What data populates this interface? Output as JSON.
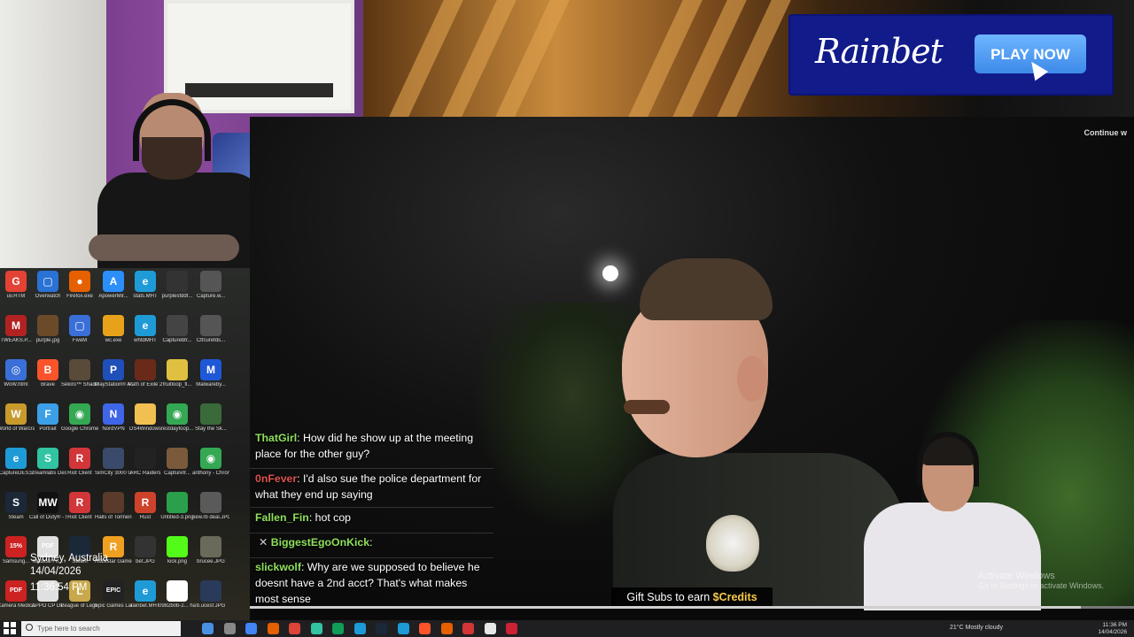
{
  "ad": {
    "brand": "Rainbet",
    "cta": "PLAY NOW"
  },
  "video": {
    "continue_label": "Continue w",
    "gift": {
      "prefix": "Gift Subs to earn ",
      "highlight": "$Credits"
    },
    "progress_fraction": 0.94,
    "activate_title": "Activate Windows",
    "activate_sub": "Go to Settings to activate Windows."
  },
  "chat": [
    {
      "user": "ThatGirl",
      "color": "#8ee05a",
      "text": "How did he show up at the meeting place for the other guy?"
    },
    {
      "user": "0nFever",
      "color": "#d9534f",
      "text": "I'd also sue the police department for what they end up saying"
    },
    {
      "user": "Fallen_Fin",
      "color": "#8ee05a",
      "text": "hot cop"
    },
    {
      "user": "BiggestEgoOnKick",
      "color": "#8ee05a",
      "text": ""
    },
    {
      "user": "slickwolf",
      "color": "#8ee05a",
      "text": "Why are we supposed to believe he doesnt have a 2nd acct? That's what makes most sense"
    }
  ],
  "desktop": {
    "location": "Sydney, Australia",
    "date": "14/04/2026",
    "time": "11:36:54 PM",
    "icons": [
      {
        "label": "uv.HTM",
        "color": "#e34234",
        "glyph": "G"
      },
      {
        "label": "Overwatch",
        "color": "#2a72d5",
        "glyph": "▢"
      },
      {
        "label": "Firefox.exe",
        "color": "#e66000",
        "glyph": "●"
      },
      {
        "label": "ApowerMir...",
        "color": "#2c8ef8",
        "glyph": "A"
      },
      {
        "label": "stats.MHT",
        "color": "#1e9bd7",
        "glyph": "e"
      },
      {
        "label": "purplesfddf...",
        "color": "#333333",
        "glyph": ""
      },
      {
        "label": "Capture.w...",
        "color": "#555555",
        "glyph": ""
      },
      {
        "label": "TWEAKS.P...",
        "color": "#b22222",
        "glyph": "M"
      },
      {
        "label": "purple.jpg",
        "color": "#6b4a2a",
        "glyph": ""
      },
      {
        "label": "FiveM",
        "color": "#3a6fd8",
        "glyph": "▢"
      },
      {
        "label": "wc.exe",
        "color": "#e8a21a",
        "glyph": ""
      },
      {
        "label": "whtdMHT",
        "color": "#1e9bd7",
        "glyph": "e"
      },
      {
        "label": "Capturebtr...",
        "color": "#444444",
        "glyph": ""
      },
      {
        "label": "Ctfcurefds...",
        "color": "#555555",
        "glyph": ""
      },
      {
        "label": "WoW.html",
        "color": "#3a6fd8",
        "glyph": "◎"
      },
      {
        "label": "Brave",
        "color": "#fb542b",
        "glyph": "B"
      },
      {
        "label": "Sekiro™ Shadows D...",
        "color": "#5a4a3a",
        "glyph": ""
      },
      {
        "label": "PlayStation® Accessories",
        "color": "#1f4fb8",
        "glyph": "P"
      },
      {
        "label": "Path of Exile 2",
        "color": "#6a2a1a",
        "glyph": ""
      },
      {
        "label": "fruitloop_fl...",
        "color": "#e0c040",
        "glyph": ""
      },
      {
        "label": "Malwareby...",
        "color": "#1f58d6",
        "glyph": "M"
      },
      {
        "label": "World of Warcra...",
        "color": "#c89a2c",
        "glyph": "W"
      },
      {
        "label": "Portrait",
        "color": "#3c9fe8",
        "glyph": "F"
      },
      {
        "label": "Google Chrome",
        "color": "#34a853",
        "glyph": "◉"
      },
      {
        "label": "NordVPN",
        "color": "#3f65e8",
        "glyph": "N"
      },
      {
        "label": "DS4Windows",
        "color": "#f0c050",
        "glyph": ""
      },
      {
        "label": "restdayfoop...",
        "color": "#34a853",
        "glyph": "◉"
      },
      {
        "label": "Stay the Sk...",
        "color": "#3a6a3a",
        "glyph": ""
      },
      {
        "label": "CaptureDES...",
        "color": "#1e9bd7",
        "glyph": "e"
      },
      {
        "label": "Streamlabs Desktop",
        "color": "#31c3a2",
        "glyph": "S"
      },
      {
        "label": "Riot Client",
        "color": "#d13639",
        "glyph": "R"
      },
      {
        "label": "SimCity 3000 Unlimited",
        "color": "#3a4a6a",
        "glyph": ""
      },
      {
        "label": "ARC Raiders",
        "color": "#222222",
        "glyph": ""
      },
      {
        "label": "Capturefr...",
        "color": "#7a5a3a",
        "glyph": ""
      },
      {
        "label": "anthony - Chrome",
        "color": "#34a853",
        "glyph": "◉"
      },
      {
        "label": "Steam",
        "color": "#1b2838",
        "glyph": "S"
      },
      {
        "label": "Call of Duty® - Mo...",
        "color": "#111111",
        "glyph": "MW"
      },
      {
        "label": "Riot Client",
        "color": "#d13639",
        "glyph": "R"
      },
      {
        "label": "Halls of Torment",
        "color": "#5a3a2a",
        "glyph": ""
      },
      {
        "label": "Rust",
        "color": "#ce422b",
        "glyph": "R"
      },
      {
        "label": "Untitled-3.png",
        "color": "#2aa04a",
        "glyph": ""
      },
      {
        "label": "new.rb deal.JPG",
        "color": "#5a5a5a",
        "glyph": ""
      },
      {
        "label": "Samsung...",
        "color": "#cc2222",
        "glyph": "15%"
      },
      {
        "label": "Medical Fit...",
        "color": "#e0e0e0",
        "glyph": "PDF"
      },
      {
        "label": "Steam",
        "color": "#1b2838",
        "glyph": ""
      },
      {
        "label": "Rockstar Games...",
        "color": "#f0a020",
        "glyph": "R"
      },
      {
        "label": "bet.JPG",
        "color": "#333333",
        "glyph": ""
      },
      {
        "label": "kick.png",
        "color": "#53fc18",
        "glyph": ""
      },
      {
        "label": "brucee.JPG",
        "color": "#6a6a5a",
        "glyph": ""
      },
      {
        "label": "Camera Medical Fit...",
        "color": "#cc2222",
        "glyph": "PDF"
      },
      {
        "label": "APPO CP DP",
        "color": "#e0e0e0",
        "glyph": ""
      },
      {
        "label": "League of Legends",
        "color": "#c8a84a",
        "glyph": "L"
      },
      {
        "label": "Epic Games Launcher",
        "color": "#222222",
        "glyph": "EPIC"
      },
      {
        "label": "rainbet.MHT",
        "color": "#1e9bd7",
        "glyph": "e"
      },
      {
        "label": "0982b0b-2... hate2seek...",
        "color": "#ffffff",
        "glyph": ""
      },
      {
        "label": "b.ucesf.JPG",
        "color": "#2a3a5a",
        "glyph": ""
      }
    ]
  },
  "taskbar": {
    "search_placeholder": "Type here to search",
    "apps": [
      "#4a90e2",
      "#888888",
      "#4285f4",
      "#e66000",
      "#db4437",
      "#31c3a2",
      "#0f9d58",
      "#1e9bd7",
      "#1b2838",
      "#1e9bd7",
      "#fb542b",
      "#e66000",
      "#d13639",
      "#e8e8e8",
      "#cc2233"
    ],
    "weather": "21°C  Mostly cloudy",
    "clock_time": "11:36 PM",
    "clock_date": "14/04/2026"
  }
}
